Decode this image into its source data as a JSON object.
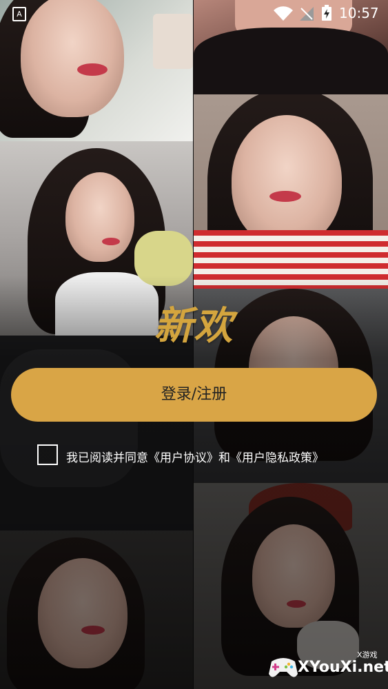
{
  "status_bar": {
    "time": "10:57",
    "sim_label": "A",
    "icons": [
      "wifi-icon",
      "signal-off-icon",
      "battery-charging-icon"
    ]
  },
  "app": {
    "title": "新欢",
    "accent_color": "#d9a546"
  },
  "login": {
    "button_label": "登录/注册"
  },
  "agreement": {
    "prefix": "我已阅读并同意",
    "user_agreement": "《用户协议》",
    "conjunction": "和",
    "privacy_policy": "《用户隐私政策》",
    "checked": false
  },
  "watermark": {
    "site": "XYouXi.net",
    "tag": "X游戏"
  }
}
